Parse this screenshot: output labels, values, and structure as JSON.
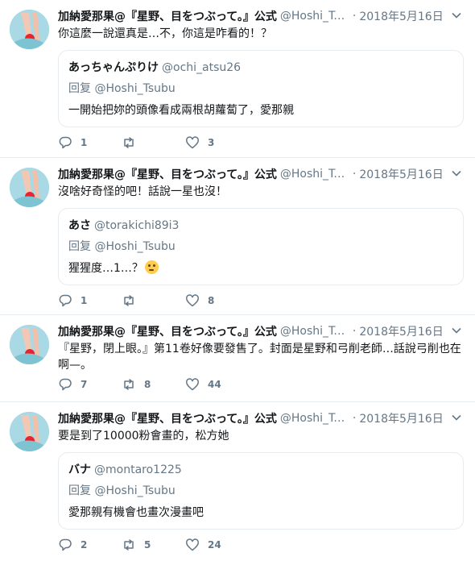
{
  "author": {
    "name": "加納愛那果@『星野、目をつぶって。』公式",
    "handle": "@Hoshi_Tsubu",
    "date": "2018年5月16日"
  },
  "separator": "·",
  "tweets": [
    {
      "text": "你這麼一說還真是…不，你這是咋看的！？",
      "quote": {
        "name": "あっちゃんぷりけ",
        "handle": "@ochi_atsu26",
        "reply_to": "回复 @Hoshi_Tsubu",
        "text": "一開始把妳的頭像看成兩根胡蘿蔔了，愛那親"
      },
      "replies": "1",
      "retweets": "",
      "likes": "3"
    },
    {
      "text": "沒啥好奇怪的吧！話說一星也沒！",
      "quote": {
        "name": "あさ",
        "handle": "@torakichi89i3",
        "reply_to": "回复 @Hoshi_Tsubu",
        "text": "猩猩度…1…？"
      },
      "replies": "1",
      "retweets": "",
      "likes": "8"
    },
    {
      "text_line1": "『星野，閉上眼。』第11卷好像要發售了。封面是星野和弓削老師…話說弓削也在",
      "text_line2": "啊—。",
      "replies": "7",
      "retweets": "8",
      "likes": "44"
    },
    {
      "text": "要是到了10000粉會畫的，松方她",
      "quote": {
        "name": "バナ",
        "handle": "@montaro1225",
        "reply_to": "回复 @Hoshi_Tsubu",
        "text": "愛那親有機會也畫次漫畫吧"
      },
      "replies": "2",
      "retweets": "5",
      "likes": "24"
    }
  ],
  "icons": {
    "reply": "reply-icon",
    "retweet": "retweet-icon",
    "like": "heart-icon",
    "menu": "chevron-down-icon",
    "emoji": "thinking-face-emoji"
  },
  "colors": {
    "secondary_text": "#657786",
    "border": "#e6ecf0",
    "text": "#14171a"
  }
}
